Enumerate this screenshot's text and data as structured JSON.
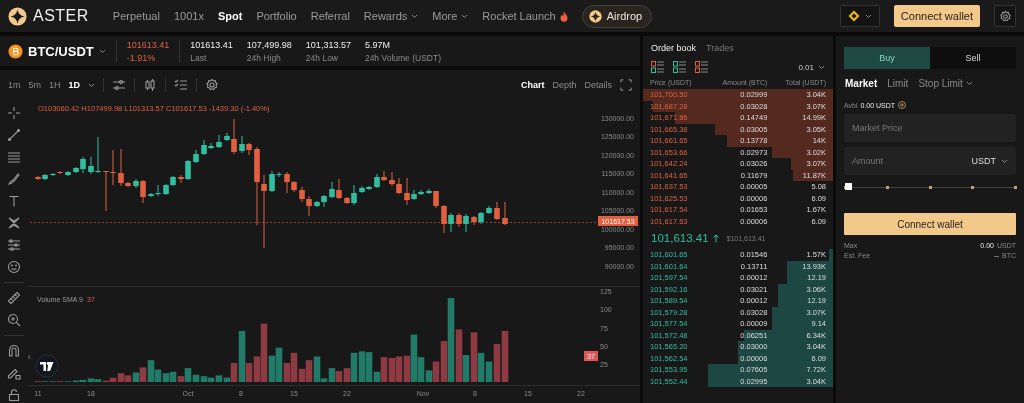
{
  "nav": {
    "logo": "ASTER",
    "items": [
      {
        "label": "Perpetual",
        "selected": false,
        "kind": "link"
      },
      {
        "label": "1001x",
        "selected": false,
        "kind": "link"
      },
      {
        "label": "Spot",
        "selected": true,
        "kind": "link"
      },
      {
        "label": "Portfolio",
        "selected": false,
        "kind": "link"
      },
      {
        "label": "Referral",
        "selected": false,
        "kind": "link"
      },
      {
        "label": "Rewards",
        "selected": false,
        "kind": "menu"
      },
      {
        "label": "More",
        "selected": false,
        "kind": "menu"
      },
      {
        "label": "Rocket Launch",
        "selected": false,
        "kind": "hot"
      }
    ],
    "airdrop": "Airdrop",
    "connect": "Connect wallet"
  },
  "ticker": {
    "pair": "BTC/USDT",
    "price": "101613.41",
    "change": "-1.91%",
    "stats": [
      {
        "value": "101613.41",
        "label": "Last"
      },
      {
        "value": "107,499.98",
        "label": "24h High"
      },
      {
        "value": "101,313.57",
        "label": "24h Low"
      },
      {
        "value": "5.97M",
        "label": "24h Volume (USDT)"
      }
    ]
  },
  "chart": {
    "intervals": [
      {
        "label": "1m",
        "selected": false
      },
      {
        "label": "5m",
        "selected": false
      },
      {
        "label": "1H",
        "selected": false
      },
      {
        "label": "1D",
        "selected": true
      }
    ],
    "views": [
      {
        "label": "Chart",
        "selected": true
      },
      {
        "label": "Depth",
        "selected": false
      },
      {
        "label": "Details",
        "selected": false
      }
    ],
    "legend": "O103060.42 H107499.98 L101313.57 C101617.53 -1439.30 (-1.40%)",
    "price_axis": [
      "130000.00",
      "125000.00",
      "120000.00",
      "115000.00",
      "110000.00",
      "105000.00",
      "100000.00",
      "95000.00",
      "90000.00"
    ],
    "last_price": "101617.53",
    "volume_label": "Volume SMA 9",
    "volume_value": "37",
    "volume_axis": [
      "125",
      "100",
      "75",
      "50",
      "25"
    ],
    "volume_tag": "37",
    "time_axis": [
      "11",
      "18",
      "Oct",
      "8",
      "15",
      "22",
      "Nov",
      "8",
      "15",
      "22"
    ]
  },
  "order_book": {
    "tabs": [
      {
        "label": "Order book",
        "selected": true
      },
      {
        "label": "Trades",
        "selected": false
      }
    ],
    "tick": "0.01",
    "columns": [
      "Price (USDT)",
      "Amount (BTC)",
      "Total (USDT)"
    ],
    "asks": [
      {
        "price": "101,700.50",
        "amount": "0.02999",
        "total": "3.04K"
      },
      {
        "price": "101,687.28",
        "amount": "0.03028",
        "total": "3.07K"
      },
      {
        "price": "101,671.86",
        "amount": "0.14749",
        "total": "14.99K"
      },
      {
        "price": "101,665.38",
        "amount": "0.03005",
        "total": "3.05K"
      },
      {
        "price": "101,661.65",
        "amount": "0.13778",
        "total": "14K"
      },
      {
        "price": "101,653.66",
        "amount": "0.02973",
        "total": "3.02K"
      },
      {
        "price": "101,642.24",
        "amount": "0.03026",
        "total": "3.07K"
      },
      {
        "price": "101,641.65",
        "amount": "0.11679",
        "total": "11.87K"
      },
      {
        "price": "101,637.53",
        "amount": "0.00005",
        "total": "5.08"
      },
      {
        "price": "101,625.53",
        "amount": "0.00006",
        "total": "6.09"
      },
      {
        "price": "101,617.54",
        "amount": "0.01653",
        "total": "1.67K"
      },
      {
        "price": "101,617.53",
        "amount": "0.00006",
        "total": "6.09"
      }
    ],
    "last": {
      "price": "101,613.41",
      "usd": "$101,613.41"
    },
    "bids": [
      {
        "price": "101,601.65",
        "amount": "0.01546",
        "total": "1.57K"
      },
      {
        "price": "101,601.64",
        "amount": "0.13711",
        "total": "13.93K"
      },
      {
        "price": "101,597.54",
        "amount": "0.00012",
        "total": "12.19"
      },
      {
        "price": "101,592.16",
        "amount": "0.03021",
        "total": "3.06K"
      },
      {
        "price": "101,589.54",
        "amount": "0.00012",
        "total": "12.19"
      },
      {
        "price": "101,579.28",
        "amount": "0.03028",
        "total": "3.07K"
      },
      {
        "price": "101,577.54",
        "amount": "0.00009",
        "total": "9.14"
      },
      {
        "price": "101,572.48",
        "amount": "0.06251",
        "total": "6.34K"
      },
      {
        "price": "101,565.20",
        "amount": "0.03000",
        "total": "3.04K"
      },
      {
        "price": "101,562.54",
        "amount": "0.00006",
        "total": "6.09"
      },
      {
        "price": "101,553.95",
        "amount": "0.07605",
        "total": "7.72K"
      },
      {
        "price": "101,552.44",
        "amount": "0.02995",
        "total": "3.04K"
      }
    ]
  },
  "order_form": {
    "sides": [
      {
        "label": "Buy",
        "selected": true
      },
      {
        "label": "Sell",
        "selected": false
      }
    ],
    "types": [
      {
        "label": "Market",
        "selected": true,
        "kind": "plain"
      },
      {
        "label": "Limit",
        "selected": false,
        "kind": "plain"
      },
      {
        "label": "Stop Limit",
        "selected": false,
        "kind": "menu"
      }
    ],
    "avbl_label": "Avbl",
    "avbl_value": "0.00 USDT",
    "price_placeholder": "Market Price",
    "amount_placeholder": "Amount",
    "amount_unit": "USDT",
    "slider": {
      "level": 0
    },
    "submit": "Connect wallet",
    "max_label": "Max",
    "max_value": "0.00",
    "max_unit": "USDT",
    "fee_label": "Est. Fee",
    "fee_value": "--",
    "fee_unit": "BTC"
  }
}
